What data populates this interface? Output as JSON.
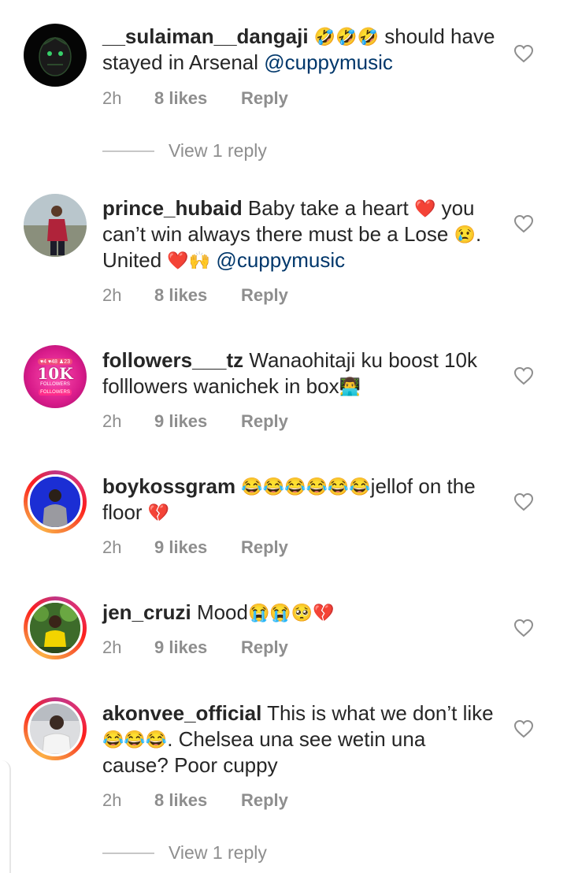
{
  "comments": [
    {
      "username": "__sulaiman__dangaji",
      "text_a": " ",
      "emoji_a": "🤣🤣🤣",
      "text_b": " should have stayed in Arsenal ",
      "mention": "@cuppymusic",
      "time": "2h",
      "likes": "8 likes",
      "reply": "Reply",
      "view_replies": "View 1 reply"
    },
    {
      "username": "prince_hubaid",
      "text_a": " Baby take a heart ",
      "emoji_a": "❤️",
      "text_b": " you can’t win always there must be a Lose ",
      "emoji_b": "😢",
      "text_c": ". United ",
      "emoji_c": "❤️🙌",
      "text_d": " ",
      "mention": "@cuppymusic",
      "time": "2h",
      "likes": "8 likes",
      "reply": "Reply"
    },
    {
      "username": "followers___tz",
      "text_a": " Wanaohitaji ku boost 10k folllowers wanichek in box",
      "emoji_a": "👨‍💻",
      "time": "2h",
      "likes": "9 likes",
      "reply": "Reply",
      "avatar_text": "10K",
      "avatar_sub1": "FOLLOWERS",
      "avatar_sub2": "FOLLOWERS",
      "avatar_stats": "♥4 ♥48 ♟23"
    },
    {
      "username": "boykossgram",
      "text_a": " ",
      "emoji_a": "😂😂😂😂😂😂",
      "text_b": "jellof on the floor ",
      "emoji_b": "💔",
      "time": "2h",
      "likes": "9 likes",
      "reply": "Reply"
    },
    {
      "username": "jen_cruzi",
      "text_a": " Mood",
      "emoji_a": "😭😭🥺💔",
      "time": "2h",
      "likes": "9 likes",
      "reply": "Reply"
    },
    {
      "username": "akonvee_official",
      "text_a": " This is what we don’t like ",
      "emoji_a": "😂😂😂",
      "text_b": ". Chelsea una see wetin una cause? Poor cuppy",
      "time": "2h",
      "likes": "8 likes",
      "reply": "Reply",
      "view_replies": "View 1 reply"
    }
  ],
  "colors": {
    "text": "#262626",
    "meta": "#8e8e8e",
    "mention": "#00376b",
    "divider": "#c7c7c7"
  },
  "icons": {
    "like": "heart-outline-icon"
  }
}
